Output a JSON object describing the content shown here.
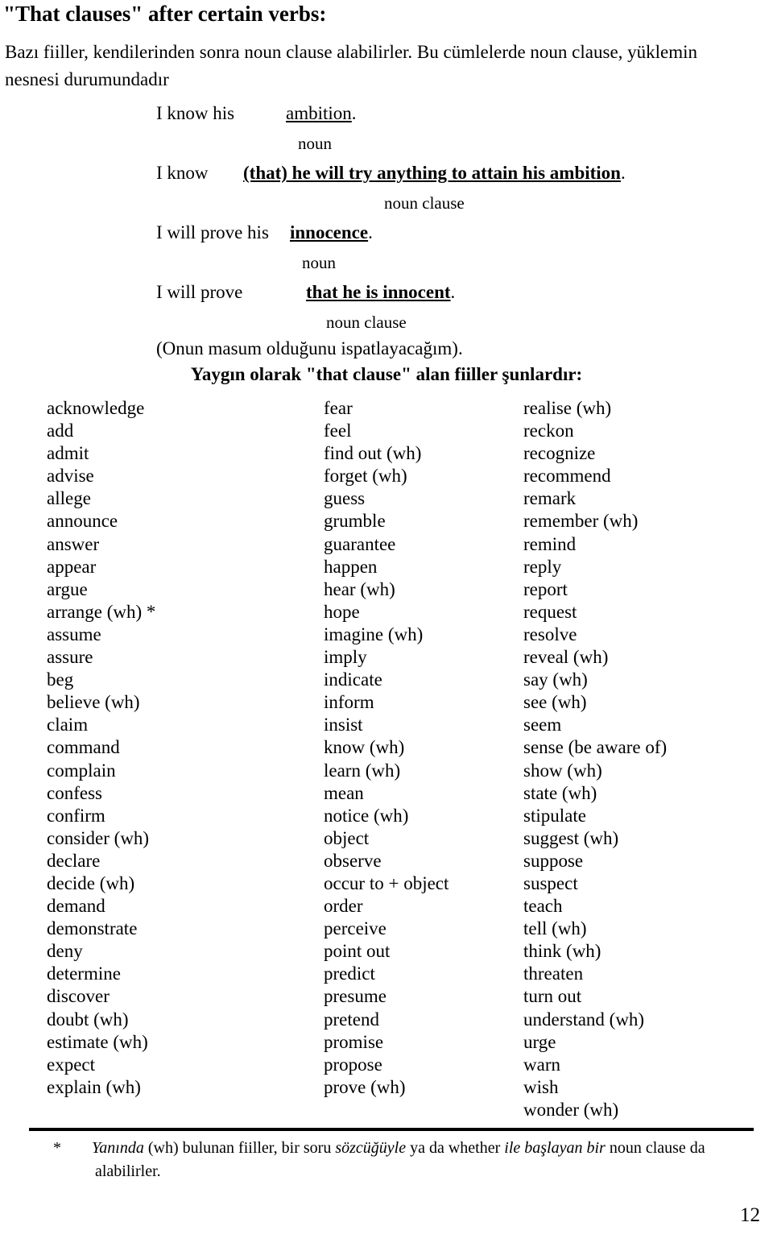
{
  "document": {
    "title": "\"That clauses\" after certain verbs:",
    "intro": "Bazı fiiller, kendilerinden sonra noun clause alabilirler. Bu cümlelerde noun clause, yüklemin nesnesi durumundadır",
    "page_number": "12"
  },
  "examples": [
    {
      "subject": "I know his",
      "object": "ambition",
      "object_punct": ".",
      "bold": false,
      "label": "noun"
    },
    {
      "subject": "I know",
      "object": "(that) he will try anything to attain his ambition",
      "object_punct": ".",
      "bold": true,
      "label": "noun clause"
    },
    {
      "subject": "I will prove his",
      "object": "innocence",
      "object_punct": ".",
      "bold": true,
      "label": "noun"
    },
    {
      "subject": "I will prove",
      "object": "that he is innocent",
      "object_punct": ".",
      "bold": true,
      "label": "noun clause"
    }
  ],
  "translation": "(Onun masum olduğunu ispatlayacağım).",
  "list": {
    "heading": "Yaygın olarak \"that clause\" alan fiiller şunlardır:",
    "columns": [
      [
        "acknowledge",
        "add",
        "admit",
        "advise",
        "allege",
        "announce",
        "answer",
        "appear",
        "argue",
        "arrange (wh) *",
        "assume",
        "assure",
        "beg",
        "believe (wh)",
        "claim",
        "command",
        "complain",
        "confess",
        "confirm",
        "consider (wh)",
        "declare",
        "decide (wh)",
        "demand",
        "demonstrate",
        "deny",
        "determine",
        "discover",
        "doubt (wh)",
        "estimate (wh)",
        "expect",
        "explain (wh)"
      ],
      [
        "fear",
        "feel",
        "find out (wh)",
        "forget (wh)",
        "guess",
        "grumble",
        "guarantee",
        "happen",
        "hear (wh)",
        "hope",
        "imagine (wh)",
        "imply",
        "indicate",
        "inform",
        "insist",
        "know (wh)",
        "learn (wh)",
        "mean",
        "notice (wh)",
        "object",
        "observe",
        "occur to + object",
        "order",
        "perceive",
        "point out",
        "predict",
        "presume",
        "pretend",
        "promise",
        "propose",
        "prove (wh)"
      ],
      [
        "realise (wh)",
        "reckon",
        "recognize",
        "recommend",
        "remark",
        "remember (wh)",
        "remind",
        "reply",
        "report",
        "request",
        "resolve",
        "reveal (wh)",
        "say (wh)",
        "see (wh)",
        "seem",
        "sense (be aware of)",
        "show (wh)",
        "state (wh)",
        "stipulate",
        "suggest (wh)",
        "suppose",
        "suspect",
        "teach",
        "tell (wh)",
        "think (wh)",
        "threaten",
        "turn out",
        "understand (wh)",
        "urge",
        "warn",
        "wish",
        "wonder (wh)"
      ]
    ]
  },
  "footnote": {
    "marker": "*",
    "segments": [
      {
        "text": "Yanında",
        "italic": true
      },
      {
        "text": " (wh) bulunan fiiller, bir soru ",
        "italic": false
      },
      {
        "text": "sözcüğüyle",
        "italic": true
      },
      {
        "text": " ya da whether ",
        "italic": false
      },
      {
        "text": "ile başlayan bir",
        "italic": true
      },
      {
        "text": " noun clause da",
        "italic": false
      }
    ],
    "line2": "alabilirler."
  }
}
